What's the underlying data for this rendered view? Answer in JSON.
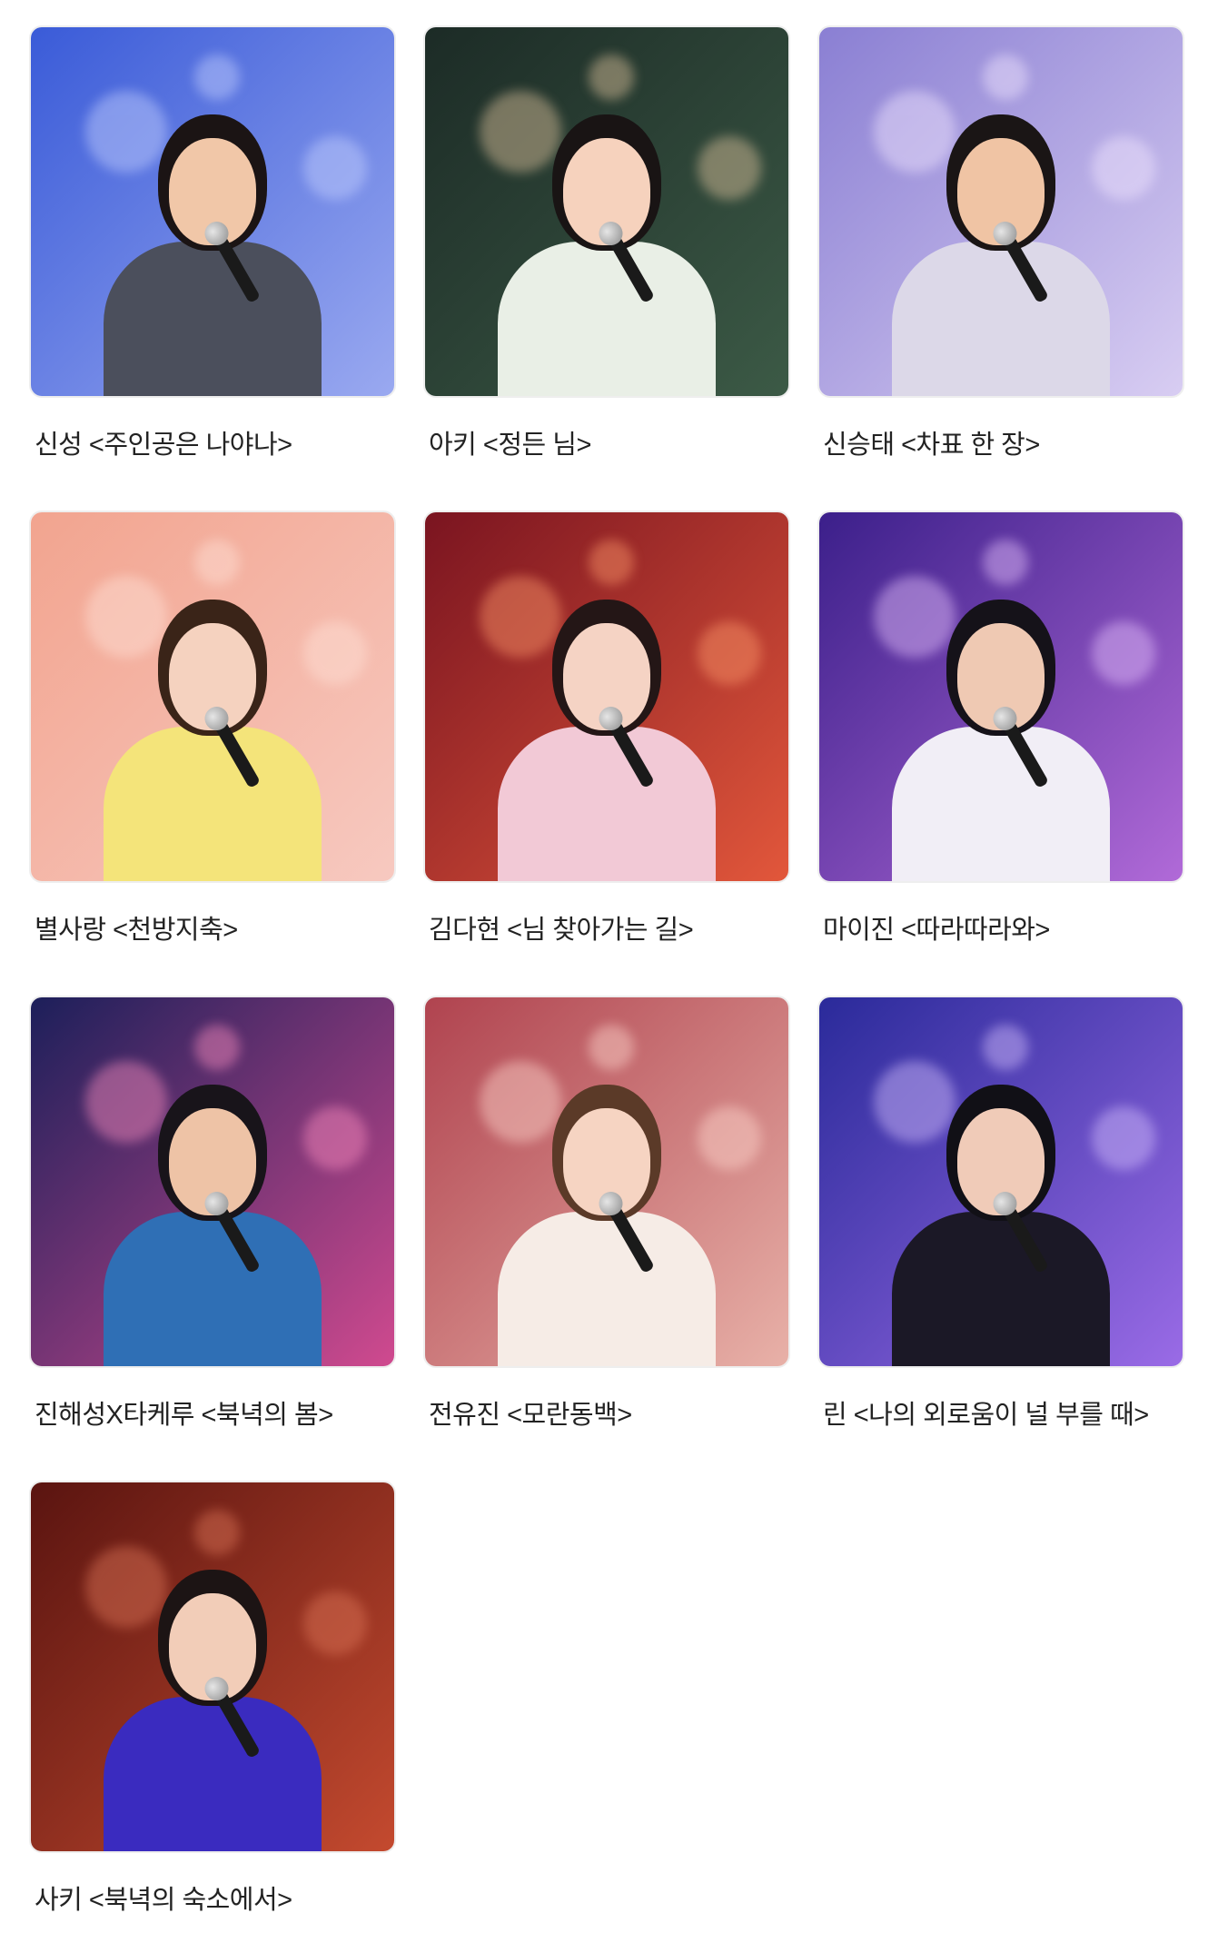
{
  "videos": [
    {
      "title": "신성 <주인공은 나야나>",
      "bg": [
        "#3a5bd8",
        "#9aa9f0"
      ],
      "accent": "#c7d2ff",
      "skin": "#f1c7a8",
      "hair": "#1b1414",
      "outfit": "#4b4f5c"
    },
    {
      "title": "아키 <정든 님>",
      "bg": [
        "#1c2b26",
        "#3c5a46"
      ],
      "accent": "#e4c7a0",
      "skin": "#f6d2bd",
      "hair": "#191414",
      "outfit": "#e9efe6"
    },
    {
      "title": "신승태 <차표 한 장>",
      "bg": [
        "#8a7fd3",
        "#d8cdf2"
      ],
      "accent": "#f3e8ff",
      "skin": "#f0c4a4",
      "hair": "#1a1515",
      "outfit": "#dcd8e8"
    },
    {
      "title": "별사랑 <천방지축>",
      "bg": [
        "#f2a48f",
        "#f7c9c0"
      ],
      "accent": "#ffe3d9",
      "skin": "#f5d2bf",
      "hair": "#3a2418",
      "outfit": "#f4e47a"
    },
    {
      "title": "김다현 <님 찾아가는 길>",
      "bg": [
        "#7a1420",
        "#e2573b"
      ],
      "accent": "#ff9a6b",
      "skin": "#f5d3c4",
      "hair": "#241616",
      "outfit": "#f2c9d6"
    },
    {
      "title": "마이진 <따라따라와>",
      "bg": [
        "#3b1f8a",
        "#b16ad8"
      ],
      "accent": "#e9c6ff",
      "skin": "#efc9b3",
      "hair": "#151219",
      "outfit": "#f1eef6"
    },
    {
      "title": "진해성X타케루 <북녁의 봄>",
      "bg": [
        "#1c1f5a",
        "#d04a8f"
      ],
      "accent": "#ff8fc0",
      "skin": "#eec3a6",
      "hair": "#18141a",
      "outfit": "#2f6fb5"
    },
    {
      "title": "전유진 <모란동백>",
      "bg": [
        "#b0434f",
        "#e8b1a8"
      ],
      "accent": "#ffd9cf",
      "skin": "#f6d4c2",
      "hair": "#5b3a28",
      "outfit": "#f6ece6"
    },
    {
      "title": "린 <나의 외로움이 널 부를 때>",
      "bg": [
        "#2a2a9a",
        "#9a6be6"
      ],
      "accent": "#d7c2ff",
      "skin": "#f0cbb8",
      "hair": "#111016",
      "outfit": "#1b1826"
    },
    {
      "title": "사키 <북녁의 숙소에서>",
      "bg": [
        "#5a1410",
        "#c44a2f"
      ],
      "accent": "#e0785a",
      "skin": "#f2cdb8",
      "hair": "#1c1414",
      "outfit": "#3a2bbf"
    }
  ]
}
